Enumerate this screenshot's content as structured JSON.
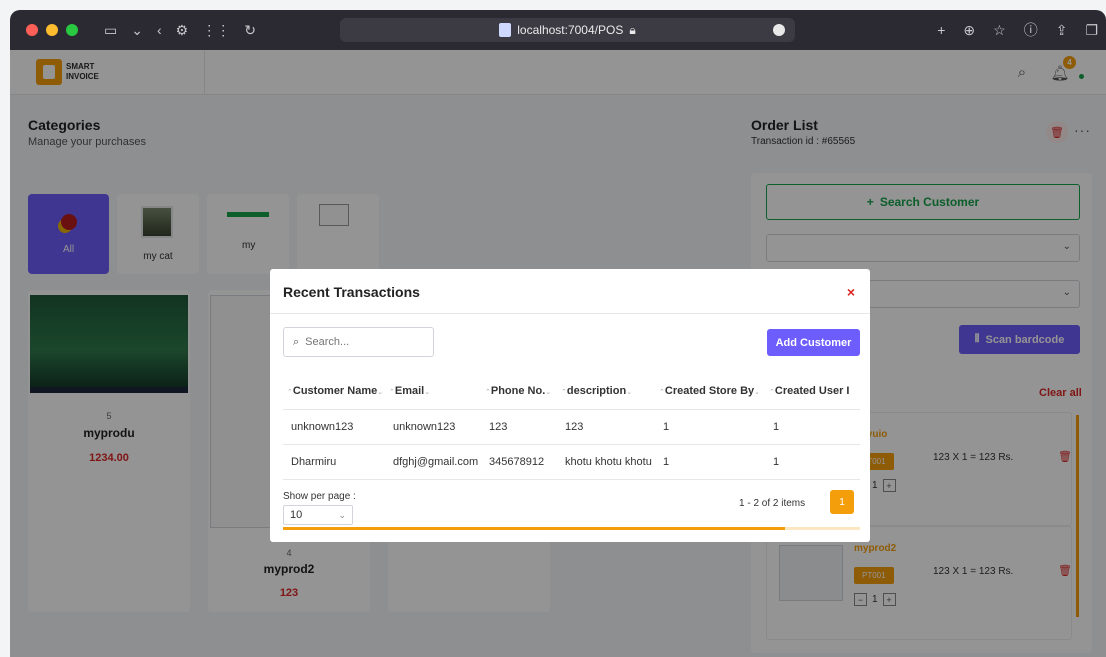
{
  "browser": {
    "url": "localhost:7004/POS"
  },
  "app": {
    "logo_line1": "SMART",
    "logo_line2": "INVOICE",
    "notification_count": "4"
  },
  "categories": {
    "title": "Categories",
    "subtitle": "Manage your purchases",
    "items": [
      {
        "label": "All"
      },
      {
        "label": "my cat"
      },
      {
        "label": "my"
      }
    ]
  },
  "products": [
    {
      "number": "5",
      "name": "myprodu",
      "price": "1234.00"
    },
    {
      "number": "4",
      "name": "myprod2",
      "price": "123"
    }
  ],
  "order": {
    "title": "Order List",
    "transaction_label": "Transaction id : #65565",
    "search_customer_label": "Search Customer",
    "scan_barcode_label": "Scan bardcode",
    "clear_all_label": "Clear all",
    "items": [
      {
        "name": "ertyuio",
        "tag": "PT001",
        "calc": "123 X 1 = 123 Rs.",
        "qty": "1"
      },
      {
        "name": "myprod2",
        "tag": "PT001",
        "calc": "123 X 1 = 123 Rs.",
        "qty": "1"
      }
    ]
  },
  "modal": {
    "title": "Recent Transactions",
    "close": "×",
    "search_placeholder": "Search...",
    "add_customer_label": "Add Customer",
    "columns": [
      "Customer Name",
      "Email",
      "Phone No.",
      "description",
      "Created Store By",
      "Created User I"
    ],
    "rows": [
      [
        "unknown123",
        "unknown123",
        "123",
        "123",
        "1",
        "1"
      ],
      [
        "Dharmiru",
        "dfghj@gmail.com",
        "345678912",
        "khotu khotu khotu",
        "1",
        "1"
      ]
    ],
    "show_per_page_label": "Show per page :",
    "per_page_value": "10",
    "page_info": "1 - 2 of 2 items",
    "current_page": "1",
    "scroll_progress_fraction": 0.87
  },
  "colors": {
    "accent_purple": "#6d5dfc",
    "accent_orange": "#f59e0b",
    "danger_red": "#dc2626",
    "success_green": "#16a34a"
  }
}
